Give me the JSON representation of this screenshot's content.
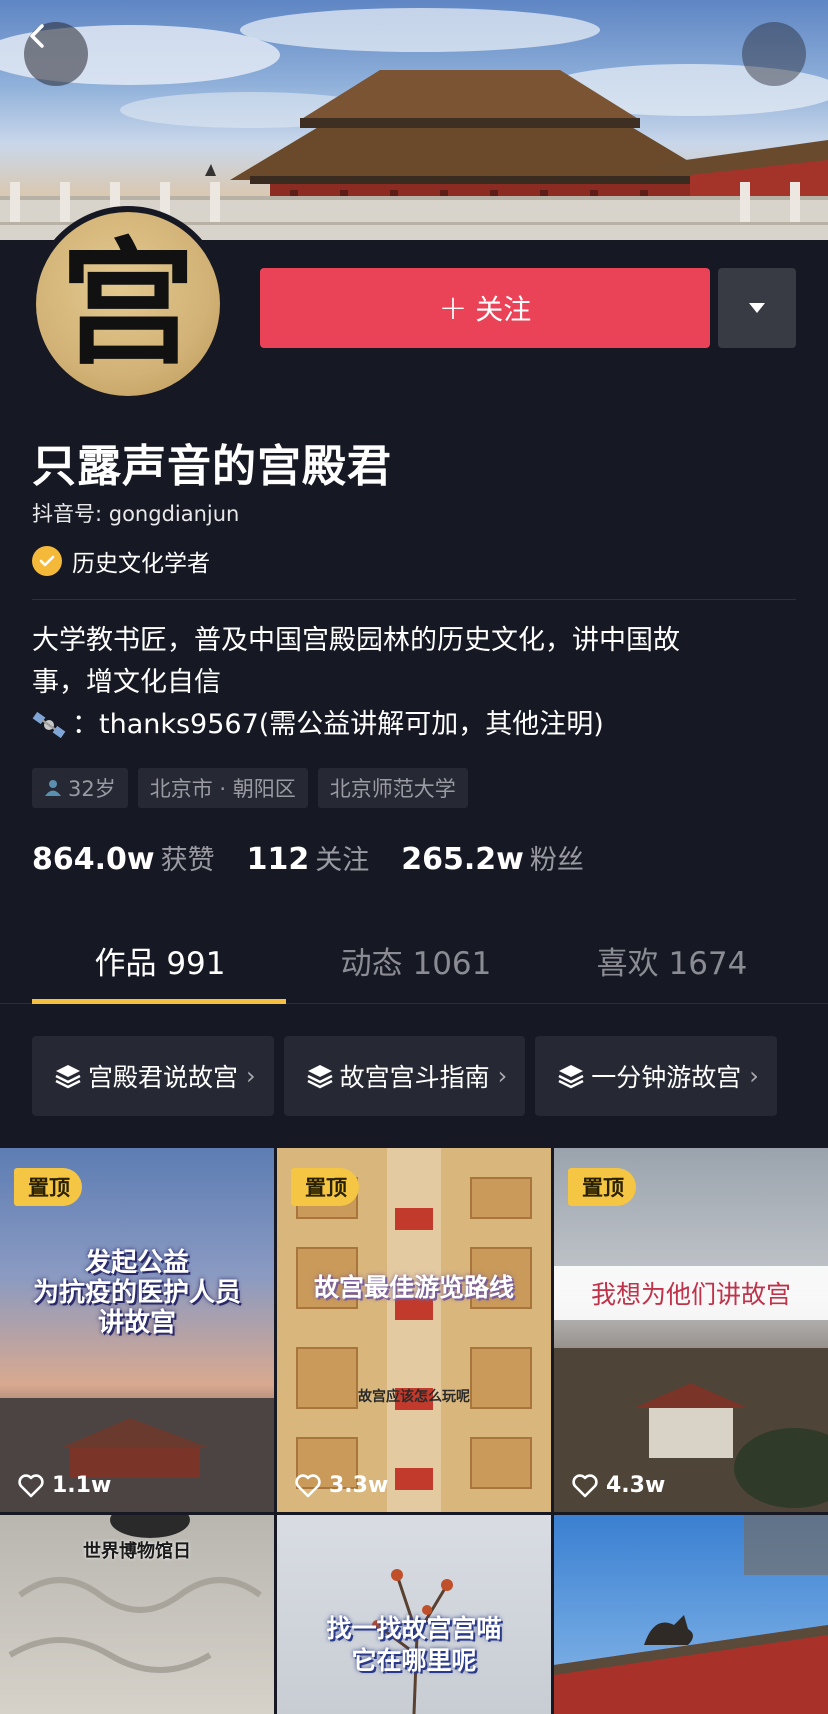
{
  "profile": {
    "nickname": "只露声音的宫殿君",
    "avatar_char": "宫",
    "douyin_id": "抖音号: gongdianjun",
    "certification": "历史文化学者",
    "bio_line1": "大学教书匠，普及中国宫殿园林的历史文化，讲中国故",
    "bio_line2": "事，增文化自信",
    "bio_contact": "：thanks9567(需公益讲解可加，其他注明)",
    "tags": [
      "32岁",
      "北京市 · 朝阳区",
      "北京师范大学"
    ]
  },
  "actions": {
    "follow_label": "关注"
  },
  "stats": [
    {
      "num": "864.0w",
      "label": "获赞"
    },
    {
      "num": "112",
      "label": "关注"
    },
    {
      "num": "265.2w",
      "label": "粉丝"
    }
  ],
  "tabs": [
    {
      "label": "作品 991"
    },
    {
      "label": "动态 1061"
    },
    {
      "label": "喜欢 1674"
    }
  ],
  "collections": [
    {
      "label": "宫殿君说故宫"
    },
    {
      "label": "故宫宫斗指南"
    },
    {
      "label": "一分钟游故宫"
    }
  ],
  "videos": [
    {
      "pin": "置顶",
      "title_lines": [
        "发起公益",
        "为抗疫的医护人员",
        "讲故宫"
      ],
      "likes": "1.1w"
    },
    {
      "pin": "置顶",
      "title_lines": [
        "故宫最佳游览路线"
      ],
      "subtitle": "故宫应该怎么玩呢",
      "likes": "3.3w"
    },
    {
      "pin": "置顶",
      "title_lines": [
        "我想为他们讲故宫"
      ],
      "likes": "4.3w"
    },
    {
      "title_lines": [
        "世界博物馆日"
      ]
    },
    {
      "title_lines": [
        "找一找故宫宫喵",
        "它在哪里呢"
      ]
    },
    {
      "title_lines": []
    }
  ],
  "colors": {
    "background": "#161823",
    "follow_button": "#ea4256",
    "accent_yellow": "#f5c042",
    "pin_badge": "#f5c544"
  },
  "icons": [
    "back-arrow-icon",
    "triangle-down-icon",
    "check-icon",
    "satellite-icon",
    "person-icon",
    "layers-icon",
    "chevron-right-icon",
    "heart-icon"
  ]
}
